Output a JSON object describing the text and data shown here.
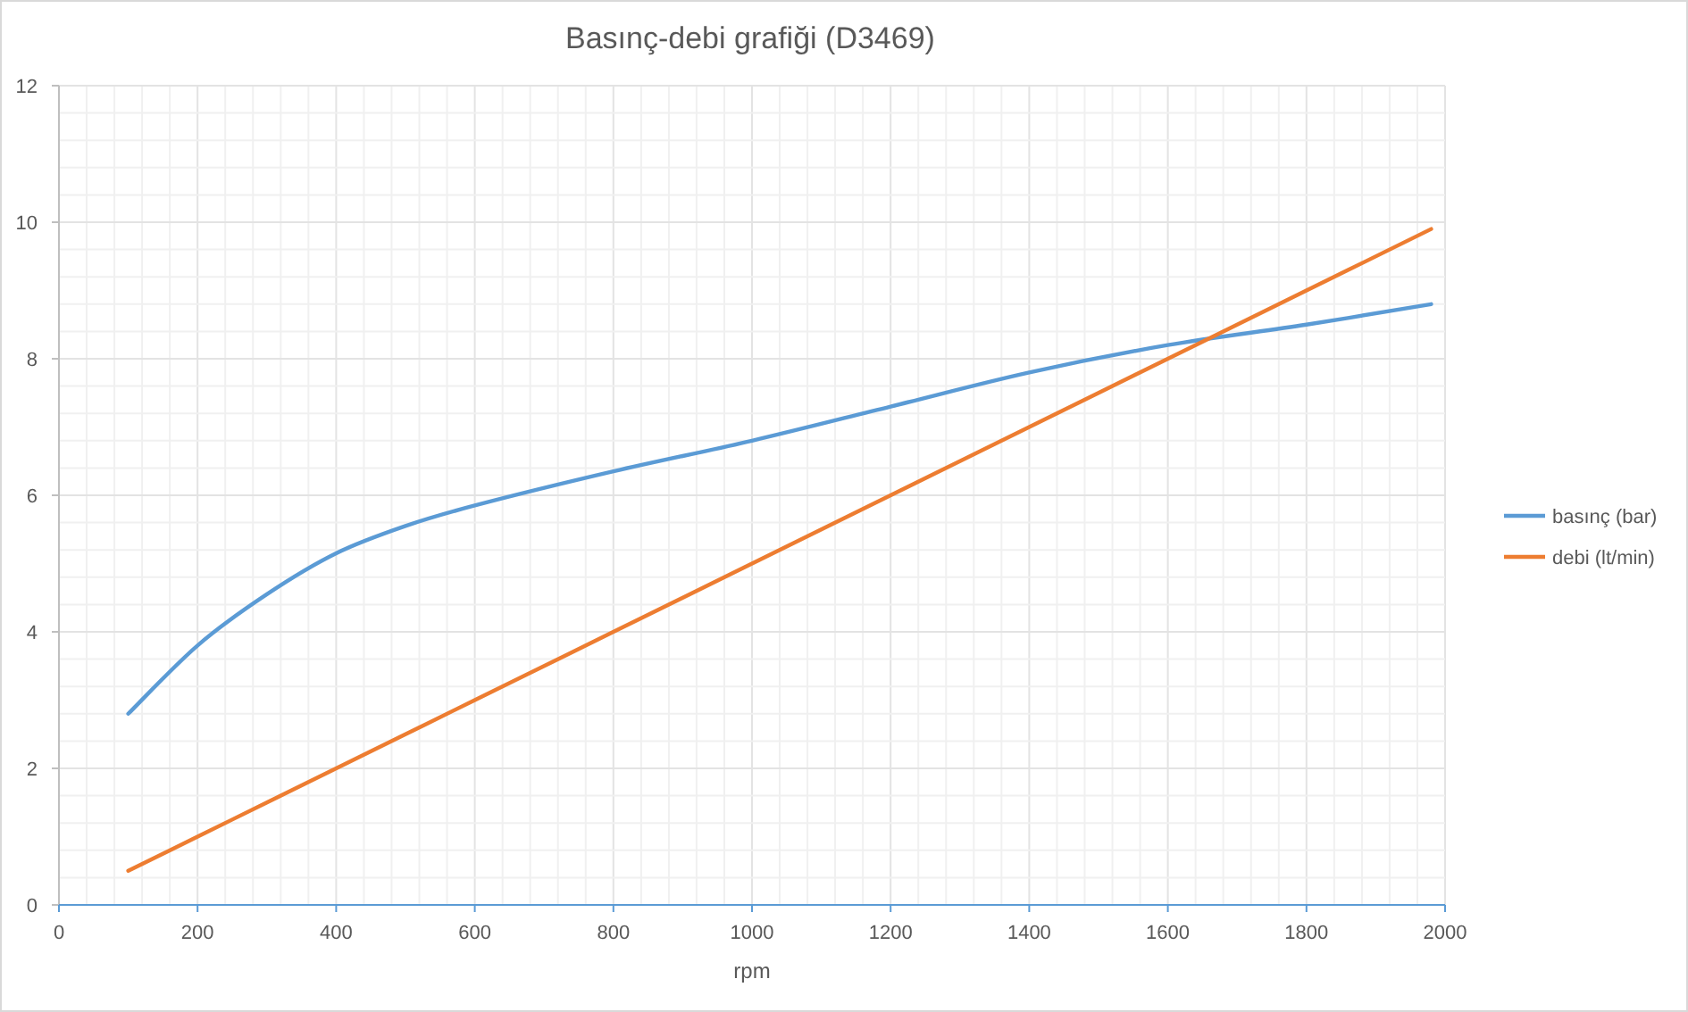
{
  "chart": {
    "chart_data": {
      "type": "line",
      "title": "Basınç-debi grafiği (D3469)",
      "xlabel": "rpm",
      "x": [
        100,
        200,
        300,
        400,
        500,
        600,
        800,
        1000,
        1200,
        1400,
        1600,
        1800,
        1980
      ],
      "series": [
        {
          "name": "basınç (bar)",
          "color": "#5b9bd5",
          "values": [
            2.8,
            3.8,
            4.55,
            5.15,
            5.55,
            5.85,
            6.35,
            6.8,
            7.3,
            7.8,
            8.2,
            8.5,
            8.8
          ]
        },
        {
          "name": "debi (lt/min)",
          "color": "#ed7d31",
          "values": [
            0.5,
            1,
            1.5,
            2,
            2.5,
            3,
            4,
            5,
            6,
            7,
            8,
            9,
            9.9
          ]
        }
      ],
      "xlim": [
        0,
        2000
      ],
      "ylim": [
        0,
        12
      ],
      "xticks": [
        0,
        200,
        400,
        600,
        800,
        1000,
        1200,
        1400,
        1600,
        1800,
        2000
      ],
      "yticks": [
        0,
        2,
        4,
        6,
        8,
        10,
        12
      ],
      "grid": true,
      "legend": true
    }
  }
}
